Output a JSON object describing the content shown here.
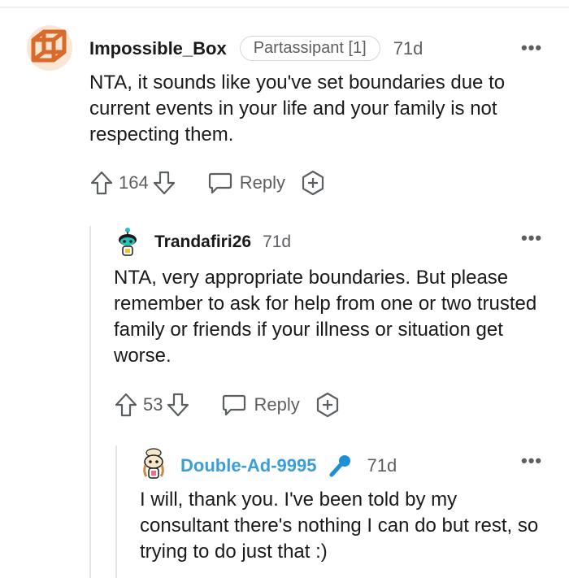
{
  "comments": [
    {
      "username": "Impossible_Box",
      "flair": "Partassipant [1]",
      "timestamp": "71d",
      "body": "NTA, it sounds like you've set boundaries due to current events in your life and your family is not respecting them.",
      "votes": "164",
      "reply_label": "Reply",
      "avatar_icon": "wire-cube-avatar-icon"
    },
    {
      "username": "Trandafiri26",
      "timestamp": "71d",
      "body": "NTA, very appropriate boundaries. But please remember to ask for help from one or two trusted family or friends if your illness or situation get worse.",
      "votes": "53",
      "reply_label": "Reply",
      "avatar_icon": "snoo-avatar-icon"
    },
    {
      "username": "Double-Ad-9995",
      "is_op": true,
      "timestamp": "71d",
      "body": "I will, thank you. I've been told by my consultant there's nothing I can do but rest, so trying to do just that :)",
      "badge_icon": "microphone-icon",
      "avatar_icon": "snoo-avatar-icon"
    }
  ],
  "more_label": "•••",
  "colors": {
    "op_username": "#3a9ed8",
    "meta_text": "#5c5f62",
    "thread_line": "#e4e6e8",
    "avatar_orange": "#d86a2a"
  }
}
